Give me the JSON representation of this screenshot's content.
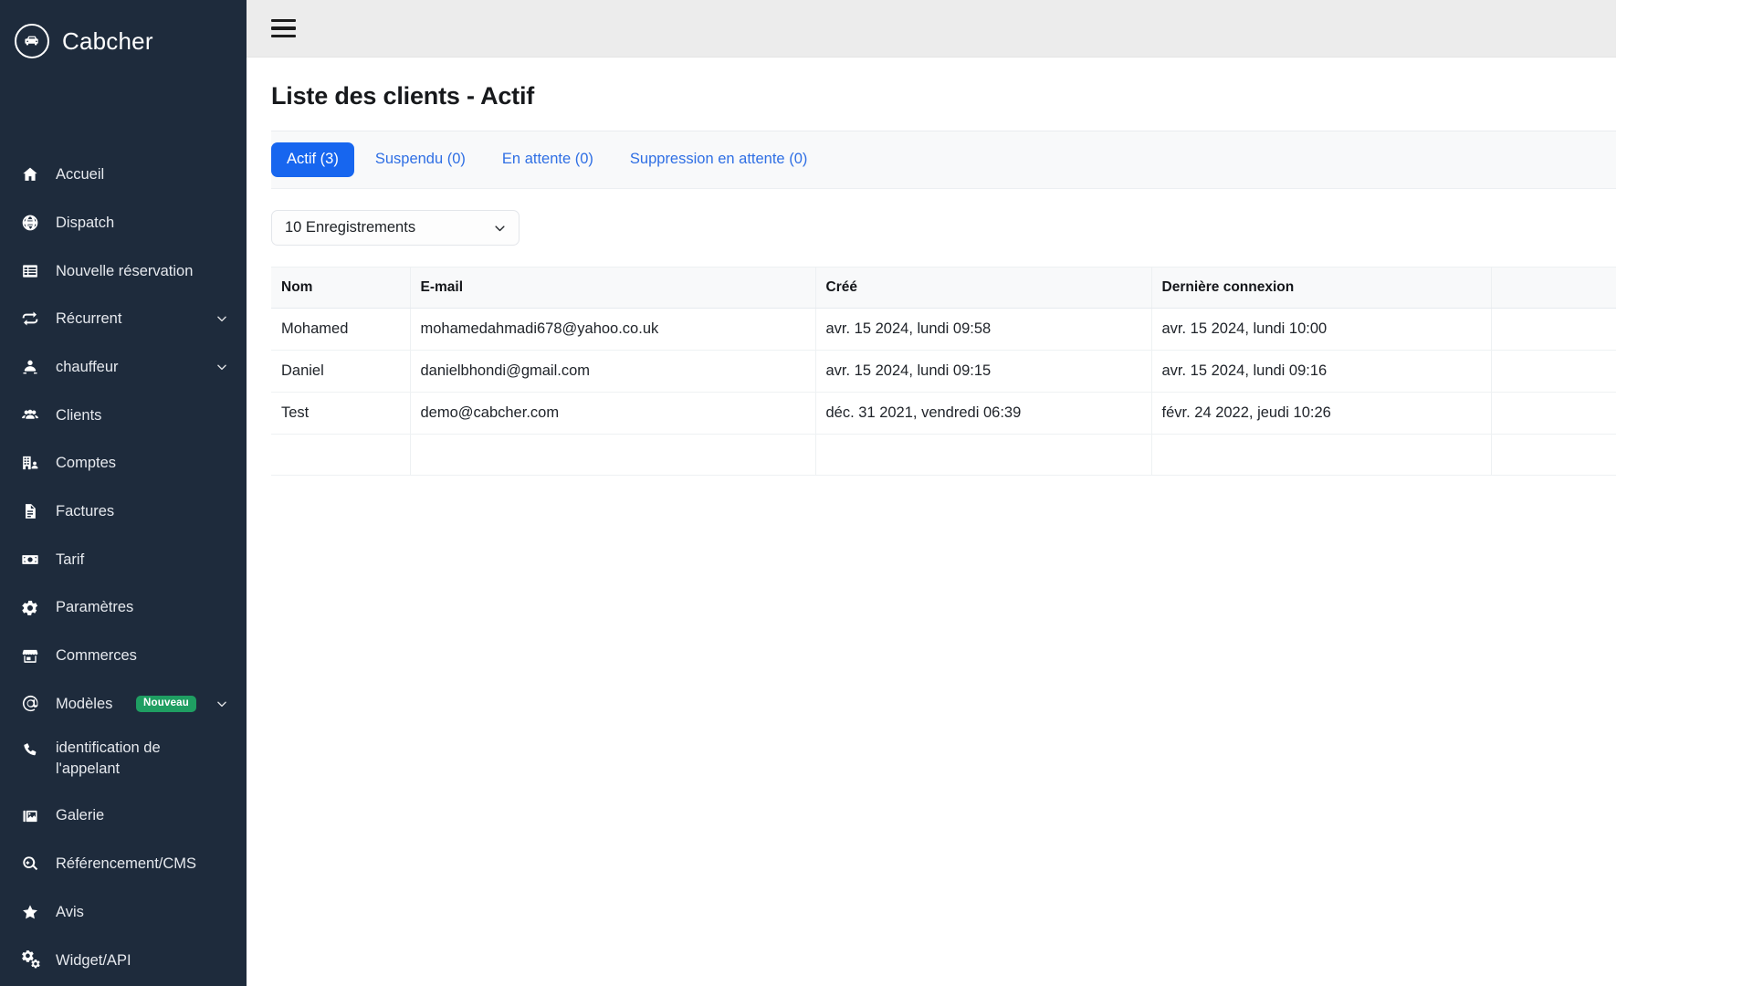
{
  "brand": {
    "name": "Cabcher",
    "logo_icon": "taxi-car-circle-icon"
  },
  "sidebar": {
    "items": [
      {
        "label": "Accueil",
        "icon": "home-icon",
        "caret": false,
        "badge": null
      },
      {
        "label": "Dispatch",
        "icon": "globe-icon",
        "caret": false,
        "badge": null
      },
      {
        "label": "Nouvelle réservation",
        "icon": "table-grid-icon",
        "caret": false,
        "badge": null
      },
      {
        "label": "Récurrent",
        "icon": "repeat-arrows-icon",
        "caret": true,
        "badge": null
      },
      {
        "label": "chauffeur",
        "icon": "driver-person-icon",
        "caret": true,
        "badge": null
      },
      {
        "label": "Clients",
        "icon": "users-group-icon",
        "caret": false,
        "badge": null
      },
      {
        "label": "Comptes",
        "icon": "building-user-icon",
        "caret": false,
        "badge": null
      },
      {
        "label": "Factures",
        "icon": "invoice-document-icon",
        "caret": false,
        "badge": null
      },
      {
        "label": "Tarif",
        "icon": "money-bill-icon",
        "caret": false,
        "badge": null
      },
      {
        "label": "Paramètres",
        "icon": "gear-icon",
        "caret": false,
        "badge": null
      },
      {
        "label": "Commerces",
        "icon": "storefront-icon",
        "caret": false,
        "badge": null
      },
      {
        "label": "Modèles",
        "icon": "at-sign-icon",
        "caret": true,
        "badge": "Nouveau"
      },
      {
        "label": "identification de l'appelant",
        "icon": "phone-icon",
        "caret": false,
        "badge": null
      },
      {
        "label": "Galerie",
        "icon": "image-gallery-icon",
        "caret": false,
        "badge": null
      },
      {
        "label": "Référencement/CMS",
        "icon": "search-magnifier-icon",
        "caret": false,
        "badge": null
      },
      {
        "label": "Avis",
        "icon": "star-icon",
        "caret": false,
        "badge": null
      },
      {
        "label": "Widget/API",
        "icon": "gears-icon",
        "caret": false,
        "badge": null
      }
    ]
  },
  "topbar": {
    "menu_toggle_icon": "hamburger-menu-icon"
  },
  "page": {
    "title": "Liste des clients - Actif"
  },
  "tabs": [
    {
      "label": "Actif (3)",
      "active": true
    },
    {
      "label": "Suspendu (0)",
      "active": false
    },
    {
      "label": "En attente (0)",
      "active": false
    },
    {
      "label": "Suppression en attente (0)",
      "active": false
    }
  ],
  "records_select": {
    "value": "10 Enregistrements",
    "caret_icon": "chevron-down-icon"
  },
  "table": {
    "columns": [
      "Nom",
      "E-mail",
      "Créé",
      "Dernière connexion",
      ""
    ],
    "rows": [
      {
        "nom": "Mohamed",
        "email": "mohamedahmadi678@yahoo.co.uk",
        "cree": "avr. 15 2024, lundi 09:58",
        "derniere_connexion": "avr. 15 2024, lundi 10:00",
        "extra": ""
      },
      {
        "nom": "Daniel",
        "email": "danielbhondi@gmail.com",
        "cree": "avr. 15 2024, lundi 09:15",
        "derniere_connexion": "avr. 15 2024, lundi 09:16",
        "extra": ""
      },
      {
        "nom": "Test",
        "email": "demo@cabcher.com",
        "cree": "déc. 31 2021, vendredi 06:39",
        "derniere_connexion": "févr. 24 2022, jeudi 10:26",
        "extra": ""
      }
    ]
  },
  "colors": {
    "sidebar_bg": "#1e2b3c",
    "accent_blue": "#1766ef",
    "link_blue": "#2f6fe4",
    "badge_green": "#1f9e62",
    "topbar_bg": "#ececec",
    "table_header_bg": "#f8f9fa"
  }
}
